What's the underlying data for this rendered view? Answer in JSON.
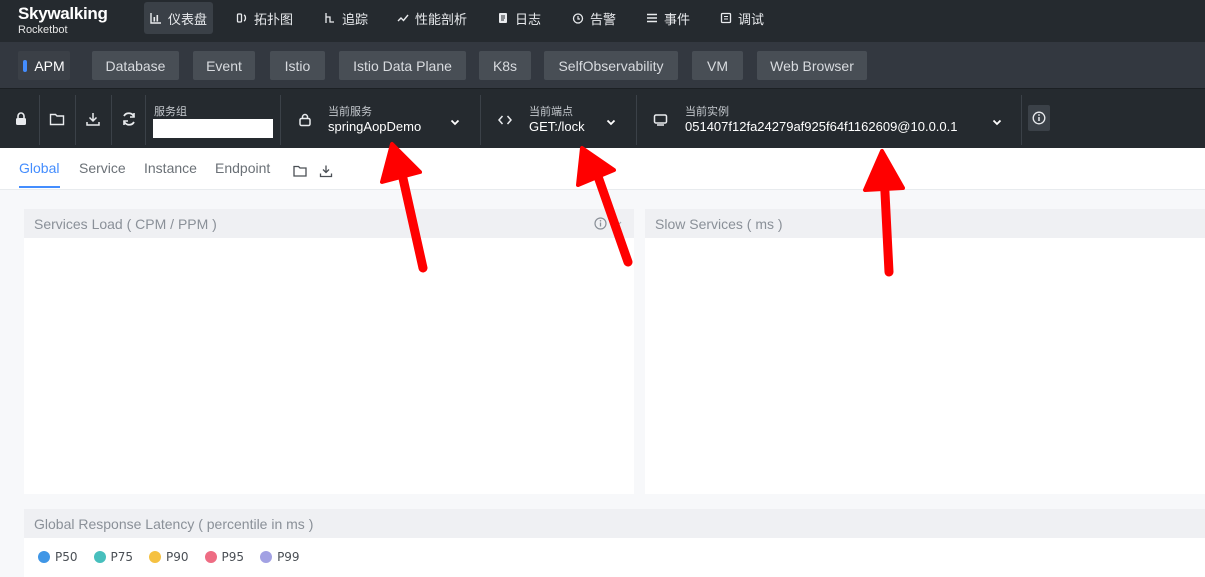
{
  "logo": {
    "brand": "Skywalking",
    "subtitle": "Rocketbot"
  },
  "nav": {
    "items": [
      {
        "label": "仪表盘",
        "icon": "dashboard-icon",
        "active": true
      },
      {
        "label": "拓扑图",
        "icon": "topology-icon"
      },
      {
        "label": "追踪",
        "icon": "trace-icon"
      },
      {
        "label": "性能剖析",
        "icon": "profile-icon"
      },
      {
        "label": "日志",
        "icon": "log-icon"
      },
      {
        "label": "告警",
        "icon": "alarm-icon"
      },
      {
        "label": "事件",
        "icon": "event-icon"
      },
      {
        "label": "调试",
        "icon": "debug-icon"
      }
    ]
  },
  "layers": [
    "APM",
    "Database",
    "Event",
    "Istio",
    "Istio Data Plane",
    "K8s",
    "SelfObservability",
    "VM",
    "Web Browser"
  ],
  "toolbar": {
    "group_label": "服务组",
    "group_value": "",
    "service_label": "当前服务",
    "service_value": "springAopDemo",
    "endpoint_label": "当前端点",
    "endpoint_value": "GET:/lock",
    "instance_label": "当前实例",
    "instance_value": "051407f12fa24279af925f64f1162609@10.0.0.1"
  },
  "tabs": [
    "Global",
    "Service",
    "Instance",
    "Endpoint"
  ],
  "panels": {
    "services_load": "Services Load ( CPM / PPM )",
    "slow_services": "Slow Services ( ms )",
    "latency": "Global Response Latency ( percentile in ms )"
  },
  "legend": [
    {
      "name": "P50",
      "color": "#3f96e6"
    },
    {
      "name": "P75",
      "color": "#47bfbd"
    },
    {
      "name": "P90",
      "color": "#f5c142"
    },
    {
      "name": "P95",
      "color": "#ee6c83"
    },
    {
      "name": "P99",
      "color": "#a2a1e3"
    }
  ],
  "colors": {
    "accent": "#448dfe",
    "nav_bg": "#252a2f",
    "annotation_arrow": "#ff0000"
  }
}
